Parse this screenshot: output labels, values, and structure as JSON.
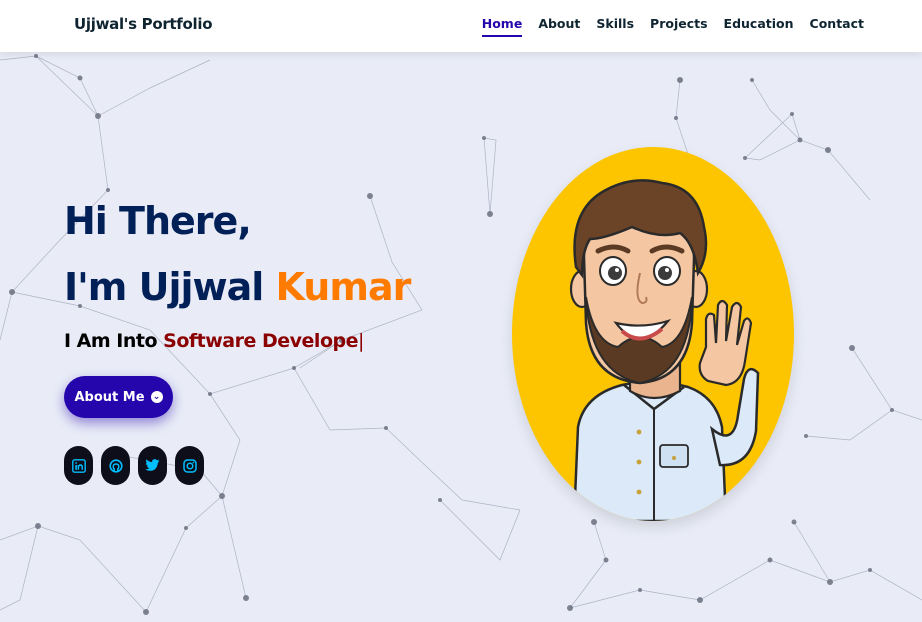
{
  "nav": {
    "brand": "Ujjwal's Portfolio",
    "links": [
      "Home",
      "About",
      "Skills",
      "Projects",
      "Education",
      "Contact"
    ],
    "active": "Home"
  },
  "hero": {
    "greeting": "Hi There,",
    "name_prefix": "I'm Ujjwal",
    "name_accent": "Kumar",
    "typed_prefix": "I Am Into",
    "typed_text": "Software Develope",
    "cursor": "|",
    "cta_label": "About Me",
    "cta_icon": "chevron-circle-down-icon"
  },
  "socials": [
    "linkedin-icon",
    "github-icon",
    "twitter-icon",
    "instagram-icon"
  ],
  "colors": {
    "primary": "#2506ad",
    "heading": "#002057",
    "accent": "#ff7b00",
    "typed": "#8b0000",
    "social_icon": "#00bfff",
    "avatar_bg": "#fcc500",
    "background": "#e9ecf7"
  }
}
